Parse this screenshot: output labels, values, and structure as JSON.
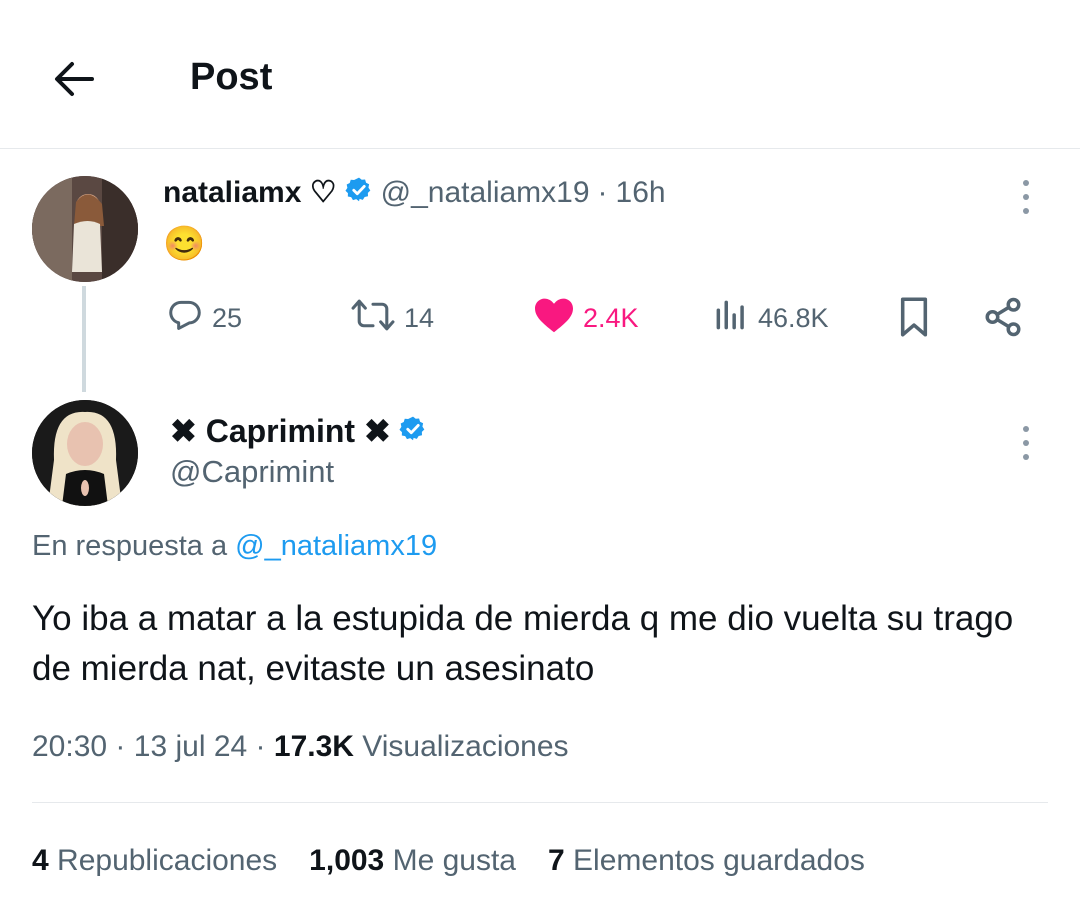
{
  "header": {
    "title": "Post"
  },
  "parent_post": {
    "display_name": "nataliamx ♡",
    "handle": "@_nataliamx19",
    "separator": "·",
    "time": "16h",
    "content": "😊",
    "actions": {
      "replies": "25",
      "reposts": "14",
      "likes": "2.4K",
      "views": "46.8K"
    }
  },
  "reply_post": {
    "display_name": "✖ Caprimint ✖",
    "handle": "@Caprimint",
    "reply_to_prefix": "En respuesta a",
    "reply_to_handle": "@_nataliamx19",
    "text": "Yo iba a matar a la estupida de mierda q me dio vuelta su trago de mierda nat, evitaste un asesinato",
    "time": "20:30",
    "date": "13 jul 24",
    "separator": "·",
    "views_count": "17.3K",
    "views_label": "Visualizaciones"
  },
  "stats": {
    "reposts_count": "4",
    "reposts_label": "Republicaciones",
    "likes_count": "1,003",
    "likes_label": "Me gusta",
    "bookmarks_count": "7",
    "bookmarks_label": "Elementos guardados"
  },
  "colors": {
    "like_pink": "#f91880",
    "verified_blue": "#1d9bf0",
    "muted_gray": "#536471",
    "text_dark": "#0f1419"
  }
}
